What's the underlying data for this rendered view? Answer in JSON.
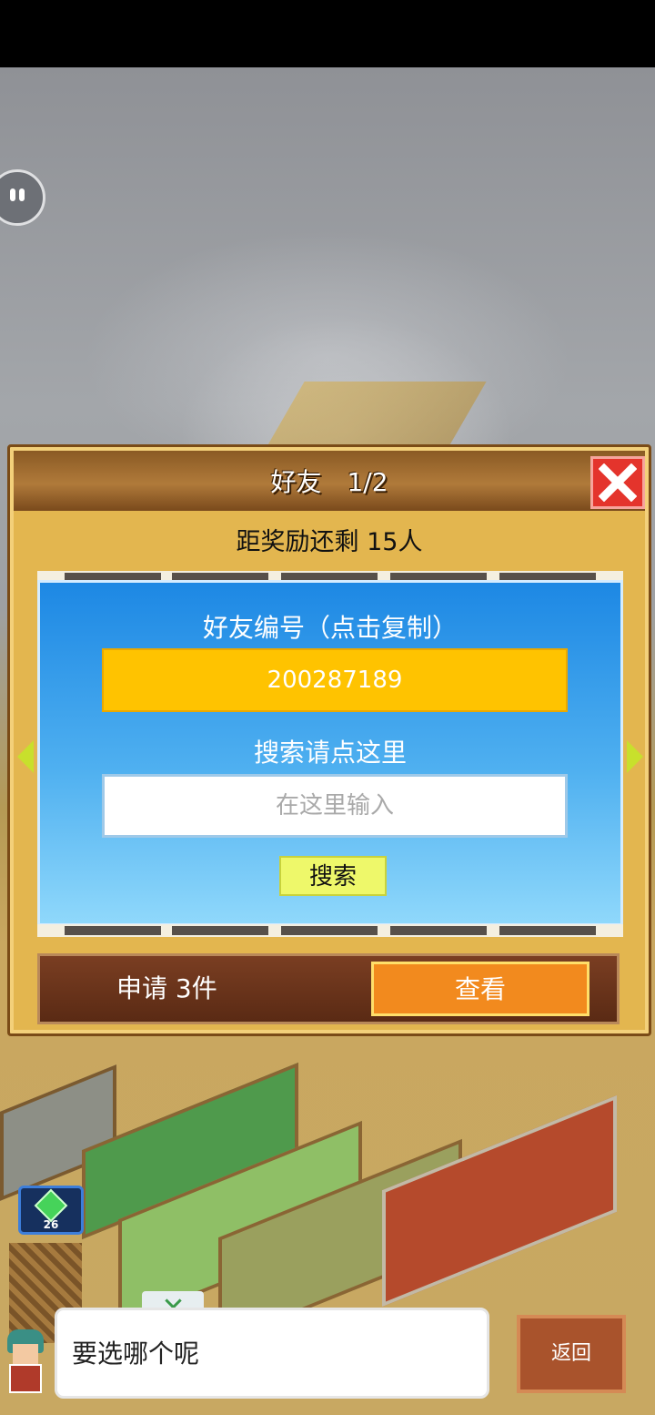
{
  "dialog": {
    "title": "好友",
    "page": "1/2",
    "reward_text": "距奖励还剩 15人",
    "friend_id_label": "好友编号（点击复制）",
    "friend_id": "200287189",
    "search_label": "搜索请点这里",
    "search_placeholder": "在这里输入",
    "search_button": "搜索",
    "requests_text": "申请 3件",
    "view_button": "查看"
  },
  "hud": {
    "level": "26",
    "speech_text": "要选哪个呢",
    "back_button": "返回"
  },
  "colors": {
    "dialog_bg": "#e3b64f",
    "panel_blue": "#1d88e4",
    "id_box": "#ffc300",
    "close_red": "#e4342c",
    "view_orange": "#f28a1e",
    "search_yellow": "#eef86a"
  }
}
